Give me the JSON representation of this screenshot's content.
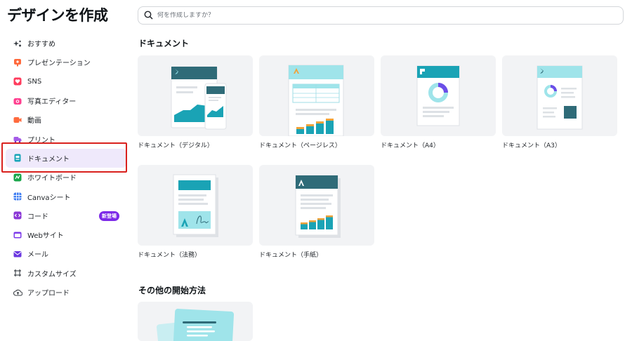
{
  "page_title": "デザインを作成",
  "search": {
    "placeholder": "何を作成しますか？"
  },
  "sidebar": {
    "items": [
      {
        "label": "おすすめ",
        "icon": "sparkle-icon"
      },
      {
        "label": "プレゼンテーション",
        "icon": "presentation-icon"
      },
      {
        "label": "SNS",
        "icon": "heart-icon"
      },
      {
        "label": "写真エディター",
        "icon": "camera-icon"
      },
      {
        "label": "動画",
        "icon": "video-icon"
      },
      {
        "label": "プリント",
        "icon": "truck-icon"
      },
      {
        "label": "ドキュメント",
        "icon": "document-icon"
      },
      {
        "label": "ホワイトボード",
        "icon": "whiteboard-icon"
      },
      {
        "label": "Canvaシート",
        "icon": "sheet-icon"
      },
      {
        "label": "コード",
        "icon": "code-icon",
        "badge": "新登場"
      },
      {
        "label": "Webサイト",
        "icon": "website-icon"
      },
      {
        "label": "メール",
        "icon": "mail-icon"
      },
      {
        "label": "カスタムサイズ",
        "icon": "custom-size-icon"
      },
      {
        "label": "アップロード",
        "icon": "upload-icon"
      }
    ],
    "active": "ドキュメント"
  },
  "documents_section": {
    "title": "ドキュメント",
    "cards": [
      {
        "label": "ドキュメント（デジタル）"
      },
      {
        "label": "ドキュメント（ページレス）"
      },
      {
        "label": "ドキュメント（A4）"
      },
      {
        "label": "ドキュメント（A3）"
      },
      {
        "label": "ドキュメント（法務）"
      },
      {
        "label": "ドキュメント（手紙）"
      }
    ]
  },
  "other_section": {
    "title": "その他の開始方法"
  },
  "colors": {
    "accent": "#7d2ae8",
    "highlight": "#d9211e",
    "teal": "#1aa3b5",
    "dark_teal": "#2f6b78",
    "orange": "#f0a33a"
  }
}
